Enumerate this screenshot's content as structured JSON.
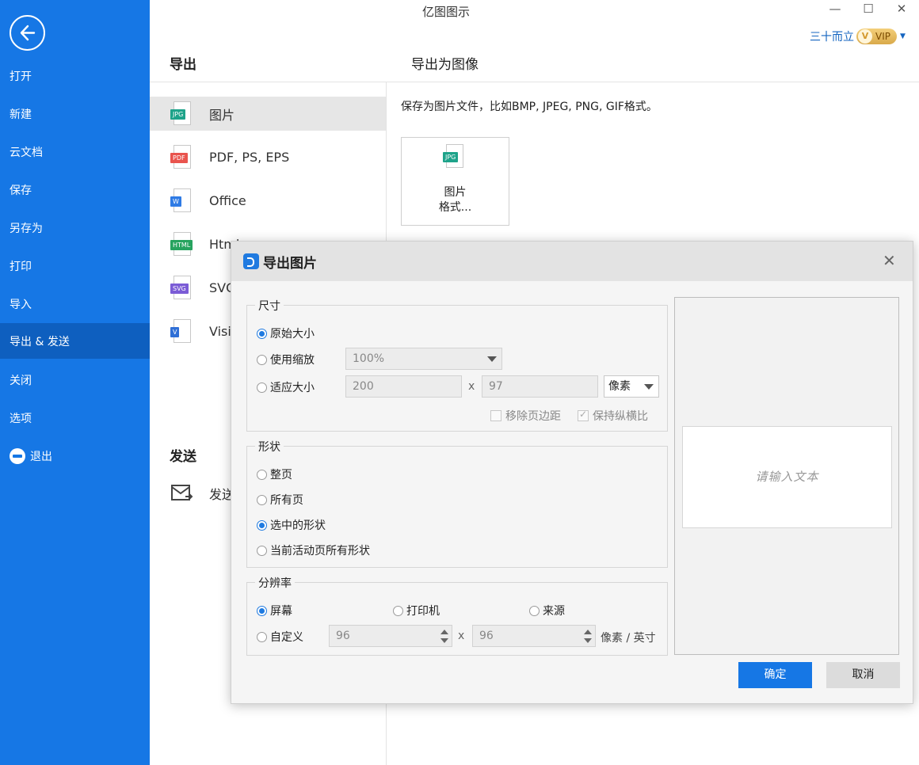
{
  "app": {
    "title": "亿图图示",
    "minimize": "—",
    "maximize": "☐",
    "close": "✕"
  },
  "user": {
    "name": "三十而立",
    "badge": "VIP"
  },
  "sidebar": {
    "items": [
      {
        "label": "打开"
      },
      {
        "label": "新建"
      },
      {
        "label": "云文档"
      },
      {
        "label": "保存"
      },
      {
        "label": "另存为"
      },
      {
        "label": "打印"
      },
      {
        "label": "导入"
      },
      {
        "label": "导出 & 发送",
        "active": true
      },
      {
        "label": "关闭"
      },
      {
        "label": "选项"
      },
      {
        "label": "退出"
      }
    ]
  },
  "export_panel": {
    "title": "导出",
    "formats": [
      {
        "label": "图片",
        "tag": "JPG",
        "color": "#1ea38a",
        "active": true
      },
      {
        "label": "PDF, PS, EPS",
        "tag": "PDF",
        "color": "#e9544e"
      },
      {
        "label": "Office",
        "tag": "W",
        "color": "#2f7be5"
      },
      {
        "label": "Html",
        "tag": "HTML",
        "color": "#27a35f"
      },
      {
        "label": "SVG",
        "tag": "SVG",
        "color": "#7b5cd6"
      },
      {
        "label": "Visio",
        "tag": "V",
        "color": "#2f6fd6"
      }
    ],
    "send_title": "发送",
    "send_item": "发送"
  },
  "right_panel": {
    "title": "导出为图像",
    "description": "保存为图片文件，比如BMP, JPEG, PNG, GIF格式。",
    "card_line1": "图片",
    "card_line2": "格式...",
    "card_tag": "JPG"
  },
  "dialog": {
    "title": "导出图片",
    "close": "✕",
    "size_group": {
      "label": "尺寸",
      "original": "原始大小",
      "zoom": "使用缩放",
      "zoom_value": "100%",
      "fit": "适应大小",
      "width": "200",
      "x": "x",
      "height": "97",
      "unit": "像素",
      "remove_margin": "移除页边距",
      "keep_ratio": "保持纵横比"
    },
    "shape_group": {
      "label": "形状",
      "whole_page": "整页",
      "all_pages": "所有页",
      "selected": "选中的形状",
      "current_page_all": "当前活动页所有形状"
    },
    "resolution_group": {
      "label": "分辨率",
      "screen": "屏幕",
      "printer": "打印机",
      "source": "来源",
      "custom": "自定义",
      "dpi_x": "96",
      "x": "x",
      "dpi_y": "96",
      "unit": "像素 / 英寸"
    },
    "preview_placeholder": "请输入文本",
    "ok": "确定",
    "cancel": "取消"
  }
}
